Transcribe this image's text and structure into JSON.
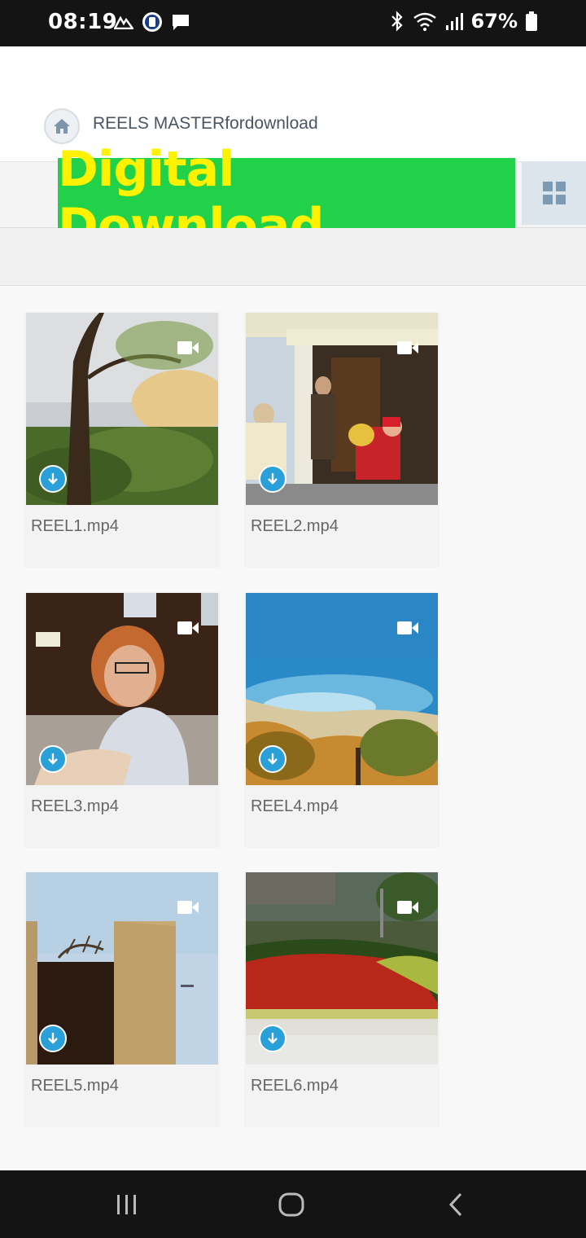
{
  "status_bar": {
    "time": "08:19",
    "battery": "67%"
  },
  "breadcrumb": {
    "folder_name": "REELS MASTERfordownload"
  },
  "banner": {
    "text": "Digital Download",
    "bg_color": "#22d14a",
    "text_color": "#fff200"
  },
  "files": [
    {
      "name": "REEL1.mp4",
      "type": "video"
    },
    {
      "name": "REEL2.mp4",
      "type": "video"
    },
    {
      "name": "REEL3.mp4",
      "type": "video"
    },
    {
      "name": "REEL4.mp4",
      "type": "video"
    },
    {
      "name": "REEL5.mp4",
      "type": "video"
    },
    {
      "name": "REEL6.mp4",
      "type": "video"
    }
  ],
  "colors": {
    "download_accent": "#2aa0d8"
  }
}
